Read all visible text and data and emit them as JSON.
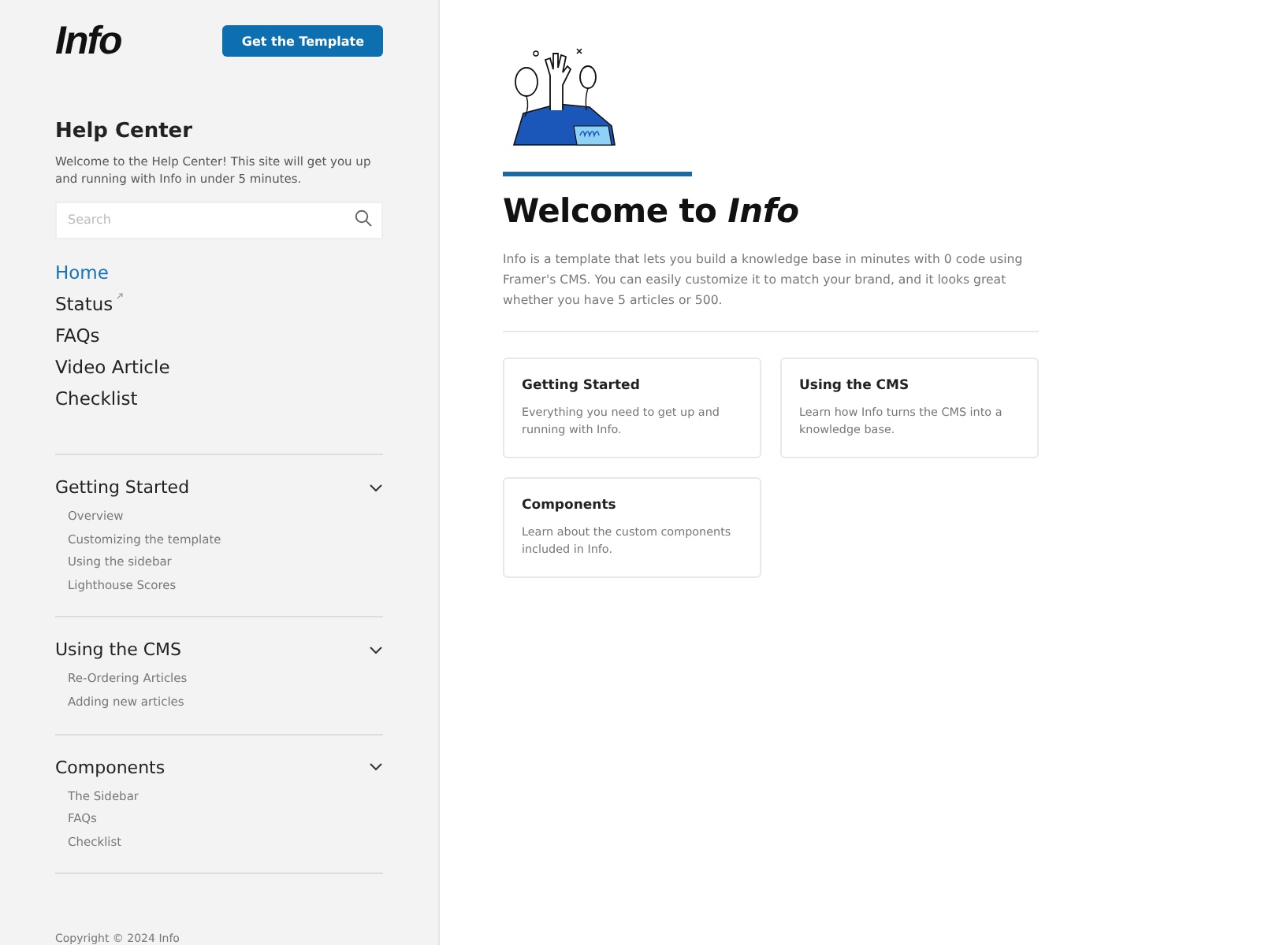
{
  "sidebar": {
    "logo": "Info",
    "cta_button": "Get the Template",
    "title": "Help Center",
    "intro": "Welcome to the Help Center! This site will get you up and running with Info in under 5 minutes.",
    "search": {
      "placeholder": "Search"
    },
    "nav": [
      {
        "label": "Home",
        "selected": true,
        "external": false
      },
      {
        "label": "Status",
        "selected": false,
        "external": true
      },
      {
        "label": "FAQs",
        "selected": false,
        "external": false
      },
      {
        "label": "Video Article",
        "selected": false,
        "external": false
      },
      {
        "label": "Checklist",
        "selected": false,
        "external": false
      }
    ],
    "sections": [
      {
        "title": "Getting Started",
        "expanded": true,
        "items": [
          "Overview",
          "Customizing the template",
          "Using the sidebar",
          "Lighthouse Scores"
        ]
      },
      {
        "title": "Using the CMS",
        "expanded": true,
        "items": [
          "Re-Ordering Articles",
          "Adding new articles"
        ]
      },
      {
        "title": "Components",
        "expanded": true,
        "items": [
          "The Sidebar",
          "FAQs",
          "Checklist"
        ]
      }
    ],
    "footer": "Copyright © 2024 Info"
  },
  "main": {
    "heading": "Welcome to *Info*",
    "description": "Info is a template that lets you build a knowledge base in minutes with 0 code using Framer's CMS. You can easily customize it to match your brand, and it looks great whether you have 5 articles or 500.",
    "cards": [
      {
        "title": "Getting Started",
        "text": "Everything you need to get up and running with Info."
      },
      {
        "title": "Using the CMS",
        "text": "Learn how Info turns the CMS into a knowledge base."
      },
      {
        "title": "Components",
        "text": "Learn about the custom components included in Info."
      }
    ]
  }
}
